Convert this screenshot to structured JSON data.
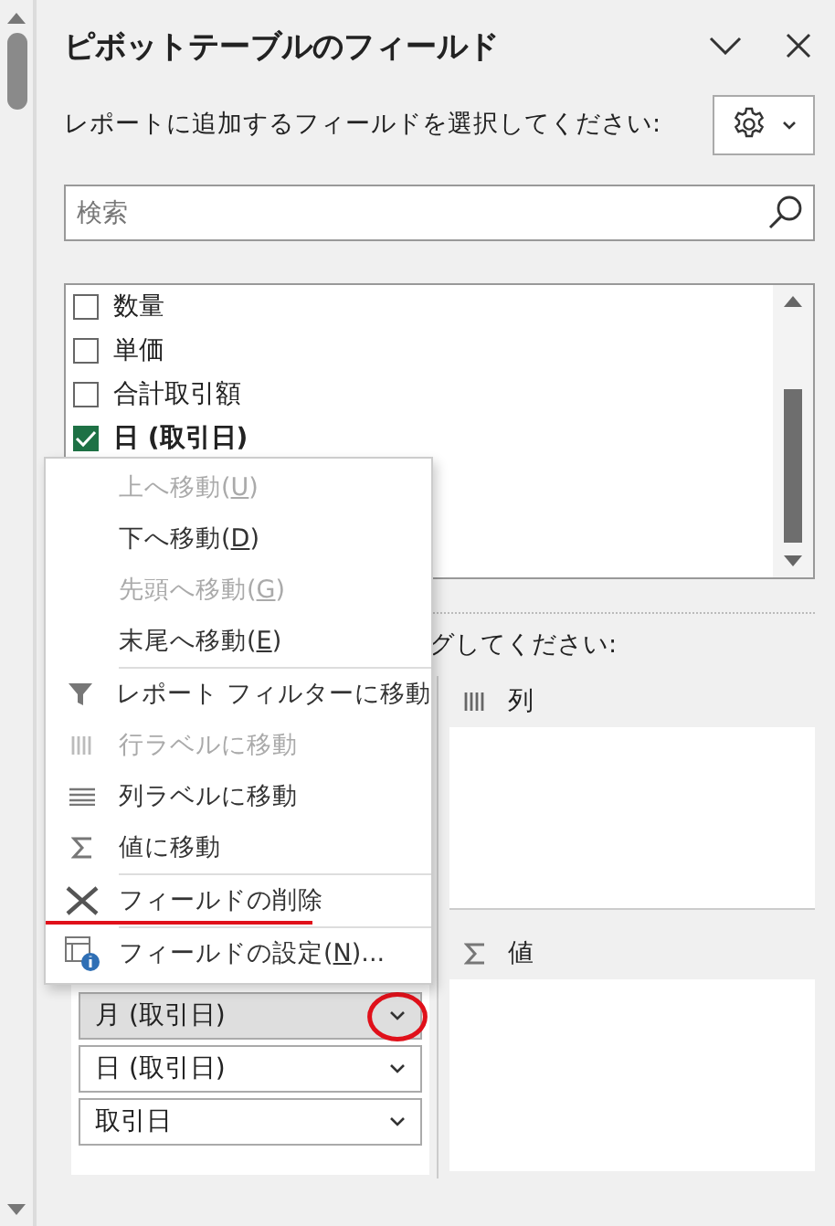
{
  "panel": {
    "title": "ピボットテーブルのフィールド",
    "instruction": "レポートに追加するフィールドを選択してください:"
  },
  "search": {
    "placeholder": "検索"
  },
  "fields": [
    {
      "label": "数量",
      "checked": false
    },
    {
      "label": "単価",
      "checked": false
    },
    {
      "label": "合計取引額",
      "checked": false
    },
    {
      "label": "日 (取引日)",
      "checked": true
    }
  ],
  "drag_hint": "グしてください:",
  "context_menu": [
    {
      "kind": "command",
      "before": "上へ移動(",
      "accel": "U",
      "after": ")",
      "disabled": true,
      "annotated": false
    },
    {
      "kind": "command",
      "before": "下へ移動(",
      "accel": "D",
      "after": ")",
      "disabled": false,
      "annotated": false
    },
    {
      "kind": "command",
      "before": "先頭へ移動(",
      "accel": "G",
      "after": ")",
      "disabled": true,
      "annotated": false
    },
    {
      "kind": "command",
      "before": "末尾へ移動(",
      "accel": "E",
      "after": ")",
      "disabled": false,
      "annotated": false
    },
    {
      "kind": "separator"
    },
    {
      "kind": "command",
      "before": "レポート フィルターに移動",
      "disabled": false,
      "annotated": false
    },
    {
      "kind": "command",
      "before": "行ラベルに移動",
      "disabled": true,
      "annotated": false
    },
    {
      "kind": "command",
      "before": "列ラベルに移動",
      "disabled": false,
      "annotated": false
    },
    {
      "kind": "command",
      "before": "値に移動",
      "disabled": false,
      "annotated": false
    },
    {
      "kind": "separator"
    },
    {
      "kind": "command",
      "before": "フィールドの削除",
      "disabled": false,
      "annotated": true
    },
    {
      "kind": "separator"
    },
    {
      "kind": "command",
      "before": "フィールドの設定(",
      "accel": "N",
      "after": ")...",
      "disabled": false,
      "annotated": false
    }
  ],
  "areas": {
    "columns": {
      "label": "列"
    },
    "values": {
      "label": "値"
    },
    "rows": [
      {
        "label": "月 (取引日)",
        "selected": true,
        "annotated": true
      },
      {
        "label": "日 (取引日)",
        "selected": false,
        "annotated": false
      },
      {
        "label": "取引日",
        "selected": false,
        "annotated": false
      }
    ]
  }
}
